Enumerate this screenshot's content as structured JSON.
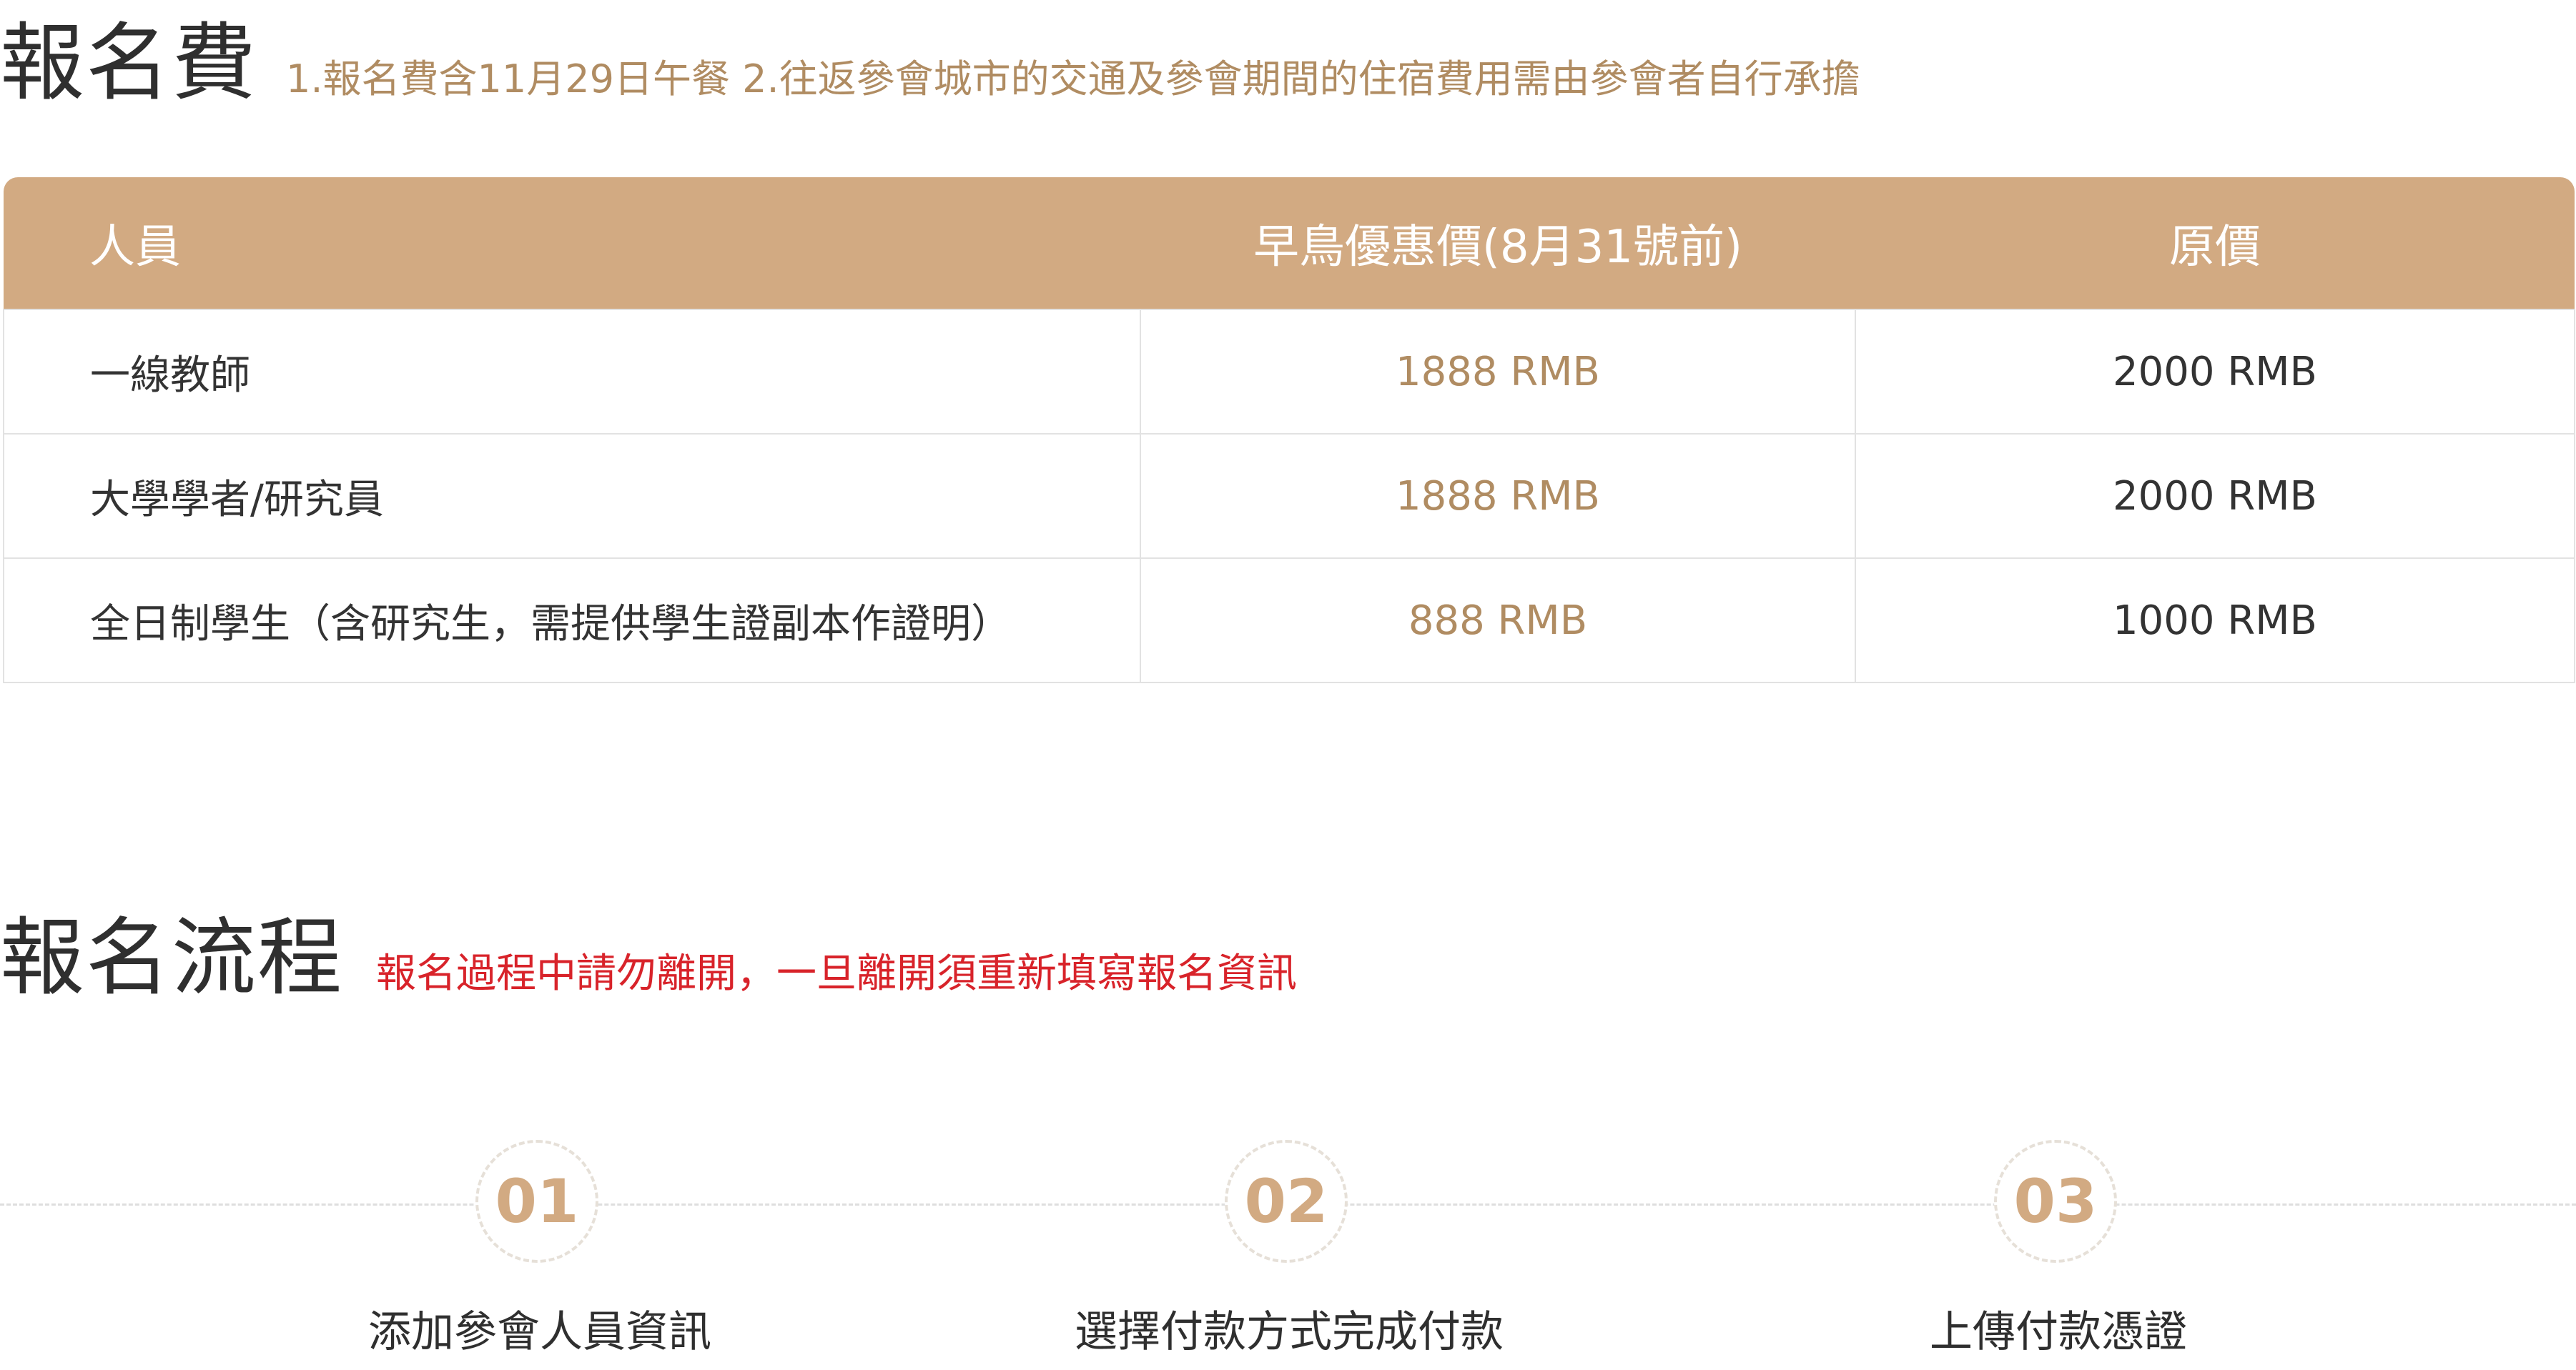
{
  "fee": {
    "title": "報名費",
    "note": "1.報名費含11月29日午餐   2.往返參會城市的交通及參會期間的住宿費用需由參會者自行承擔",
    "table": {
      "headers": [
        "人員",
        "早鳥優惠價(8月31號前)",
        "原價"
      ],
      "rows": [
        {
          "role": "一線教師",
          "early": "1888 RMB",
          "original": "2000 RMB"
        },
        {
          "role": "大學學者/研究員",
          "early": "1888 RMB",
          "original": "2000 RMB"
        },
        {
          "role": "全日制學生（含研究生，需提供學生證副本作證明）",
          "early": "888 RMB",
          "original": "1000 RMB"
        }
      ]
    }
  },
  "process": {
    "title": "報名流程",
    "note": "報名過程中請勿離開，一旦離開須重新填寫報名資訊",
    "steps": [
      {
        "number": "01",
        "label": "添加參會人員資訊"
      },
      {
        "number": "02",
        "label": "選擇付款方式完成付款"
      },
      {
        "number": "03",
        "label": "上傳付款憑證"
      }
    ]
  },
  "colors": {
    "accent": "#d2aa82",
    "accent_text": "#b08c62",
    "warning": "#d8232a",
    "text": "#333333"
  }
}
